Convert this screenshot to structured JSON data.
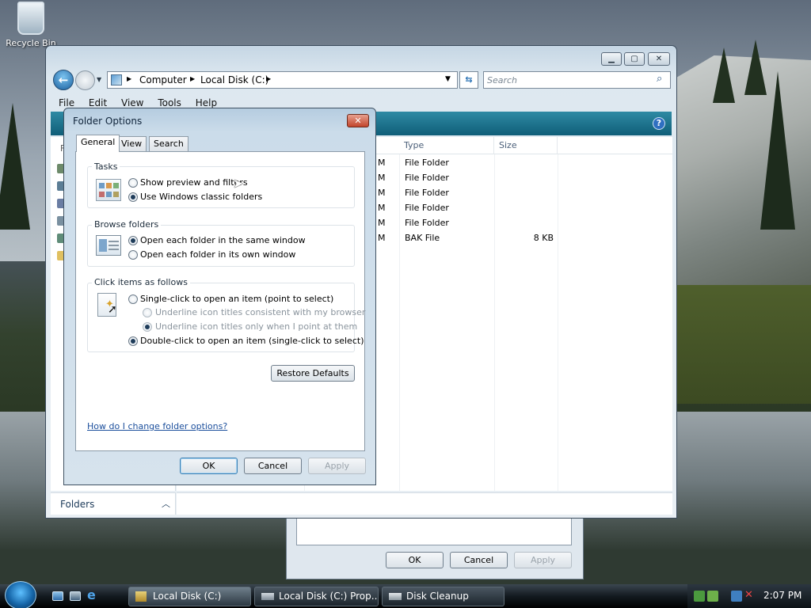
{
  "desktop": {
    "recycle_bin_label": "Recycle Bin"
  },
  "explorer": {
    "breadcrumb": [
      "Computer",
      "Local Disk (C:)"
    ],
    "search_placeholder": "Search",
    "menu": [
      "File",
      "Edit",
      "View",
      "Tools",
      "Help"
    ],
    "columns": {
      "type": "Type",
      "size": "Size"
    },
    "rows": [
      {
        "date_tail": "M",
        "type": "File Folder",
        "size": ""
      },
      {
        "date_tail": "M",
        "type": "File Folder",
        "size": ""
      },
      {
        "date_tail": "M",
        "type": "File Folder",
        "size": ""
      },
      {
        "date_tail": "M",
        "type": "File Folder",
        "size": ""
      },
      {
        "date_tail": "M",
        "type": "File Folder",
        "size": ""
      },
      {
        "date_tail": "M",
        "type": "BAK File",
        "size": "8 KB"
      }
    ],
    "folders_label": "Folders",
    "left_pane_letter": "F"
  },
  "background_dialog": {
    "ok": "OK",
    "cancel": "Cancel",
    "apply": "Apply"
  },
  "folder_options": {
    "title": "Folder Options",
    "tabs": [
      "General",
      "View",
      "Search"
    ],
    "tasks": {
      "label": "Tasks",
      "options": [
        "Show preview and filters",
        "Use Windows classic folders"
      ]
    },
    "browse": {
      "label": "Browse folders",
      "options": [
        "Open each folder in the same window",
        "Open each folder in its own window"
      ]
    },
    "click": {
      "label": "Click items as follows",
      "single": "Single-click to open an item (point to select)",
      "underline_browser": "Underline icon titles consistent with my browser",
      "underline_point": "Underline icon titles only when I point at them",
      "double": "Double-click to open an item (single-click to select)"
    },
    "restore_defaults": "Restore Defaults",
    "help_link": "How do I change folder options?",
    "ok": "OK",
    "cancel": "Cancel",
    "apply": "Apply"
  },
  "taskbar": {
    "tasks": [
      "Local Disk (C:)",
      "Local Disk (C:) Prop...",
      "Disk Cleanup"
    ],
    "clock": "2:07 PM"
  },
  "colors": {
    "accent_bar": "#1a6e8a",
    "link": "#1c4f9c"
  }
}
